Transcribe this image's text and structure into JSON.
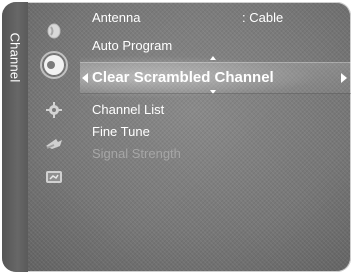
{
  "tab": {
    "label": "Channel"
  },
  "icons": [
    {
      "name": "picture-icon"
    },
    {
      "name": "channel-icon"
    },
    {
      "name": "setup-icon"
    },
    {
      "name": "input-icon"
    },
    {
      "name": "application-icon"
    }
  ],
  "menu": {
    "antenna_label": "Antenna",
    "antenna_value": ": Cable",
    "auto_program_label": "Auto Program",
    "clear_scrambled_label": "Clear Scrambled Channel",
    "channel_list_label": "Channel List",
    "fine_tune_label": "Fine Tune",
    "signal_strength_label": "Signal Strength"
  },
  "colors": {
    "accent": "#ffffff",
    "panel": "#7a7a7a",
    "disabled_text": "#a6a6a6"
  }
}
